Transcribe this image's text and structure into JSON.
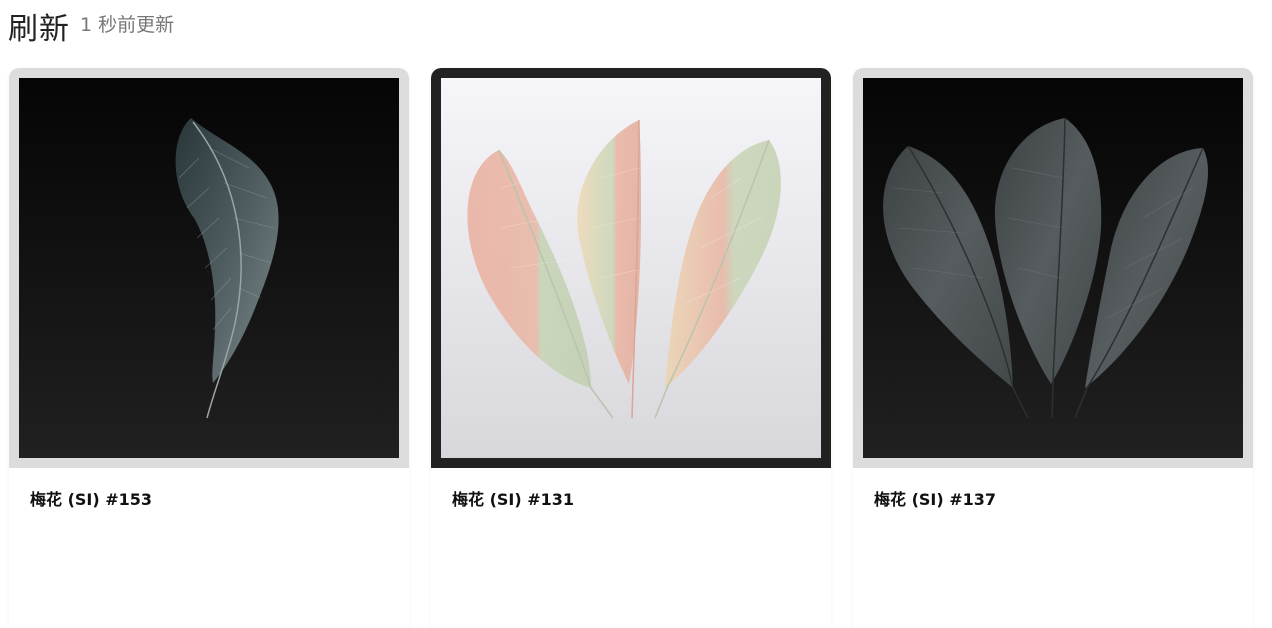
{
  "header": {
    "title": "刷新",
    "updated": "1 秒前更新"
  },
  "cards": [
    {
      "label": "梅花 (SI) #153",
      "selected": false,
      "theme": "dark",
      "feathers": 1,
      "colors": [
        "#3a4a4e",
        "#7d8c8f"
      ]
    },
    {
      "label": "梅花 (SI) #131",
      "selected": true,
      "theme": "light",
      "feathers": 3,
      "colors": [
        "#e9b3a3",
        "#c9d6b8",
        "#f0d3b6"
      ]
    },
    {
      "label": "梅花 (SI) #137",
      "selected": false,
      "theme": "dark",
      "feathers": 3,
      "colors": [
        "#4a4f52",
        "#6a7073"
      ]
    }
  ]
}
